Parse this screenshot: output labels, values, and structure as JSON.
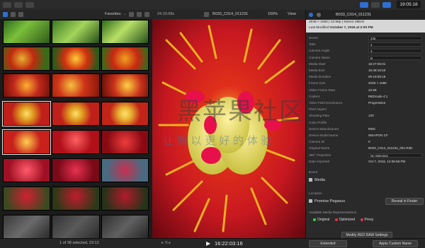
{
  "toolbar": {
    "app_icons": [
      "library-icon",
      "keywords-icon",
      "effects-icon"
    ],
    "timecode": "19:05:18"
  },
  "browser_bar": {
    "filter": "Favorites",
    "zoom_ratio": "24.33.68s",
    "clip_name": "B033_C014_011231",
    "zoom": "150%",
    "view_menu": "View"
  },
  "inspector": {
    "title": "B033_C014_011231",
    "format": "2048 × 1080 | 23.98p | Stereo 48kHz",
    "modified_label": "Last Modified",
    "modified_value": "October 7, 2016 at 2:00 PM",
    "rows": [
      {
        "label": "Scene",
        "value": "23a",
        "input": true
      },
      {
        "label": "Take",
        "value": "4",
        "input": true
      },
      {
        "label": "Camera Angle",
        "value": "3",
        "input": true
      },
      {
        "label": "Camera Name",
        "value": "B",
        "input": true
      },
      {
        "label": "Media Start",
        "value": "16:27:05:01",
        "input": false
      },
      {
        "label": "Media End",
        "value": "16:48:16:20",
        "input": false
      },
      {
        "label": "Media Duration",
        "value": "00:19:05:18",
        "input": false
      },
      {
        "label": "Frame Size",
        "value": "2048 × 1080",
        "input": false
      },
      {
        "label": "Video Frame Rate",
        "value": "23.98",
        "input": false
      },
      {
        "label": "Codecs",
        "value": "REDcode 4:1",
        "input": false
      },
      {
        "label": "Video Field Dominance",
        "value": "Progressive",
        "input": false
      },
      {
        "label": "Pixel Aspect",
        "value": "",
        "input": false
      },
      {
        "label": "Shooting Rate",
        "value": "120",
        "input": false
      },
      {
        "label": "Color Profile",
        "value": "",
        "input": false
      },
      {
        "label": "Device Manufacturer",
        "value": "RED",
        "input": false
      },
      {
        "label": "Device Model Name",
        "value": "WEAPON CF",
        "input": false
      },
      {
        "label": "Camera ID",
        "value": "0",
        "input": false
      },
      {
        "label": "Original Name",
        "value": "B033_C014_011231_001.R3D",
        "input": false
      },
      {
        "label": "360° Projection",
        "value": "No Selection",
        "input": true
      },
      {
        "label": "Date Imported",
        "value": "Oct 7, 2016, 12:05:58 PM",
        "input": false
      }
    ],
    "event_label": "Event",
    "event_value": "Media",
    "location_label": "Location",
    "location_value": "Promise Pegasus",
    "reveal_button": "Reveal in Finder",
    "media_reps_label": "Available Media Representations",
    "reps": [
      {
        "label": "Original",
        "color": "#3ecf4b"
      },
      {
        "label": "Optimized",
        "color": "#e0344a"
      },
      {
        "label": "Proxy",
        "color": "#e0344a"
      }
    ],
    "modify_button": "Modify RED RAW Settings",
    "extended_menu": "Extended",
    "apply_button": "Apply Custom Name"
  },
  "bottom": {
    "selection": "1 of 38 selected, 23:12",
    "timecode": "16:22:03:16"
  },
  "watermark": {
    "line1": "黑苹果社区",
    "line2": "让 腾 以 更 好 的 体 验"
  }
}
